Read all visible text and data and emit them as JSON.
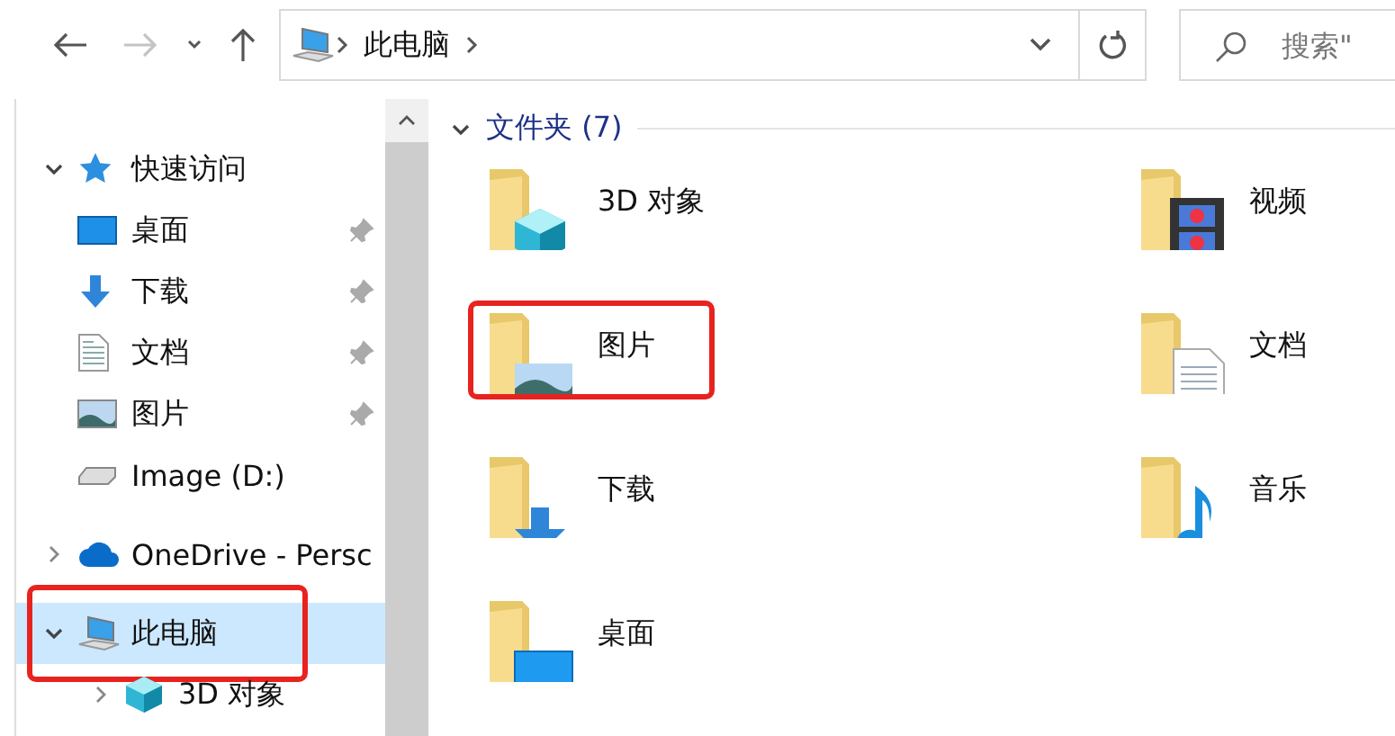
{
  "toolbar": {
    "back": {
      "disabled": false
    },
    "forward": {
      "disabled": true
    },
    "up": {
      "disabled": false
    },
    "address": {
      "path": [
        "此电脑"
      ]
    },
    "search": {
      "placeholder": "搜索\""
    }
  },
  "sidebar": {
    "items": [
      {
        "label": "快速访问",
        "kind": "star",
        "expanded": true,
        "selected": false,
        "marked": false,
        "children": [
          {
            "label": "桌面",
            "kind": "desktop",
            "pinned": true,
            "selected": false,
            "marked": false
          },
          {
            "label": "下载",
            "kind": "downloads",
            "pinned": true,
            "selected": false,
            "marked": false
          },
          {
            "label": "文档",
            "kind": "documents",
            "pinned": true,
            "selected": false,
            "marked": false
          },
          {
            "label": "图片",
            "kind": "pictures",
            "pinned": true,
            "selected": false,
            "marked": false
          },
          {
            "label": "Image (D:)",
            "kind": "drive",
            "pinned": false,
            "selected": false,
            "marked": false
          }
        ]
      },
      {
        "label": "OneDrive - Persc",
        "kind": "cloud",
        "expanded": false,
        "selected": false,
        "marked": false
      },
      {
        "label": "此电脑",
        "kind": "pc",
        "expanded": true,
        "selected": true,
        "marked": true,
        "children": [
          {
            "label": "3D 对象",
            "kind": "cube",
            "expanded": false,
            "selected": false,
            "marked": false
          }
        ]
      }
    ]
  },
  "folders": {
    "title": "文件夹 (7)",
    "expanded": true,
    "items": [
      {
        "name": "3D 对象",
        "kind": "cube",
        "marked": false
      },
      {
        "name": "视频",
        "kind": "video",
        "marked": false
      },
      {
        "name": "图片",
        "kind": "pictures",
        "marked": true
      },
      {
        "name": "文档",
        "kind": "documents",
        "marked": false
      },
      {
        "name": "下载",
        "kind": "downloads",
        "marked": false
      },
      {
        "name": "音乐",
        "kind": "music",
        "marked": false
      },
      {
        "name": "桌面",
        "kind": "desktop",
        "marked": false
      }
    ]
  }
}
